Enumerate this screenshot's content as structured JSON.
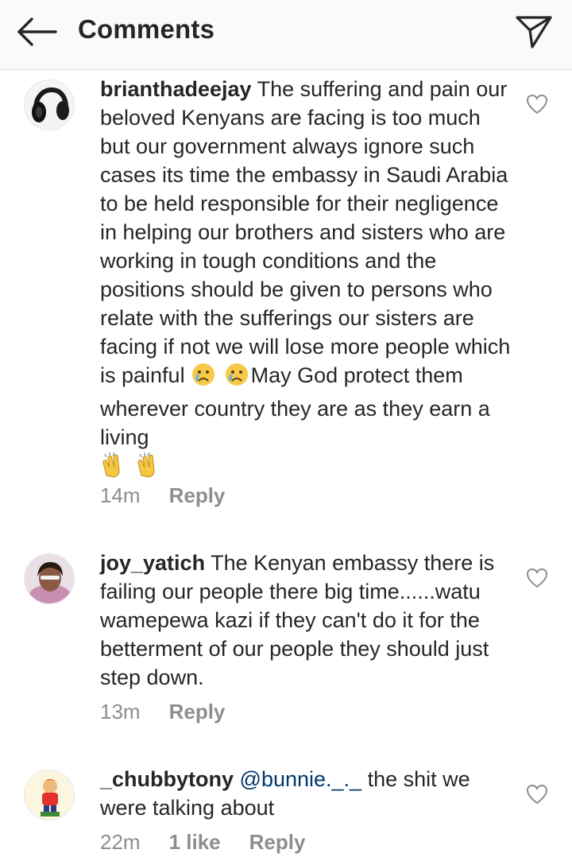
{
  "header": {
    "title": "Comments",
    "back_icon": "arrow-left-icon",
    "send_icon": "paper-plane-icon"
  },
  "comments": [
    {
      "username": "brianthadeejay",
      "text_part1": "The suffering and pain our beloved Kenyans are facing is too much but our government always ignore such cases its time the embassy in Saudi Arabia to be held responsible for their negligence in helping our brothers and sisters who are working in tough conditions and the positions should be given to persons who relate with the sufferings our sisters are facing if not we will lose more people which is painful",
      "text_part2": "May God protect them wherever country they are as they earn a living",
      "emoji_1": "crying-face-emoji",
      "emoji_2": "clapping-hands-emoji",
      "time": "14m",
      "reply_label": "Reply"
    },
    {
      "username": "joy_yatich",
      "text": "The Kenyan embassy there is failing our people there big time......watu wamepewa kazi if they can't do it for the betterment of our people they should just step down.",
      "time": "13m",
      "reply_label": "Reply"
    },
    {
      "username": "_chubbytony",
      "mention": "@bunnie._._",
      "text": "the shit we were talking about",
      "time": "22m",
      "likes": "1 like",
      "reply_label": "Reply"
    }
  ],
  "colors": {
    "header_bg": "#fafafa",
    "text": "#262626",
    "meta": "#8e8e8e",
    "mention": "#00376b"
  }
}
